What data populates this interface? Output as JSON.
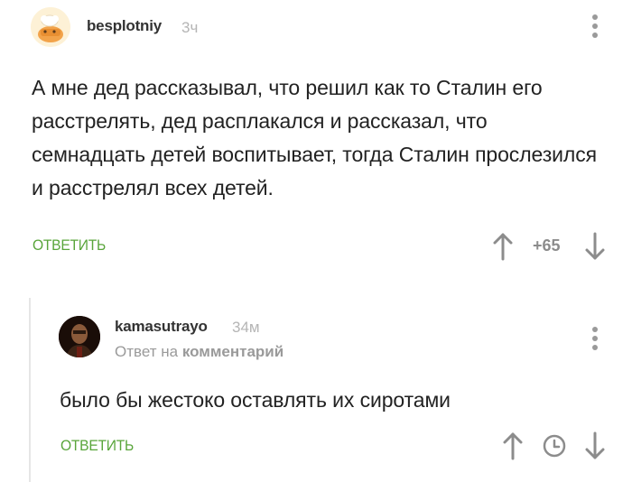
{
  "comment": {
    "username": "besplotniy",
    "time": "3ч",
    "text": "А мне дед рассказывал, что решил как то Сталин его расстрелять, дед расплакался и рассказал, что семнадцать детей воспитывает, тогда Сталин прослезился и расстрелял всех детей.",
    "reply_label": "ОТВЕТИТЬ",
    "rating": "+65"
  },
  "reply": {
    "username": "kamasutrayo",
    "time": "34м",
    "reply_to_prefix": "Ответ на",
    "reply_to_link": "комментарий",
    "text": "было бы жестоко оставлять их сиротами",
    "reply_label": "ОТВЕТИТЬ"
  },
  "icons": {
    "menu": "kebab-menu-icon",
    "upvote": "arrow-up-icon",
    "downvote": "arrow-down-icon",
    "clock": "clock-icon"
  },
  "colors": {
    "accent_green": "#59a53a",
    "muted_gray": "#9a9a9a",
    "time_gray": "#b5b5b5"
  }
}
